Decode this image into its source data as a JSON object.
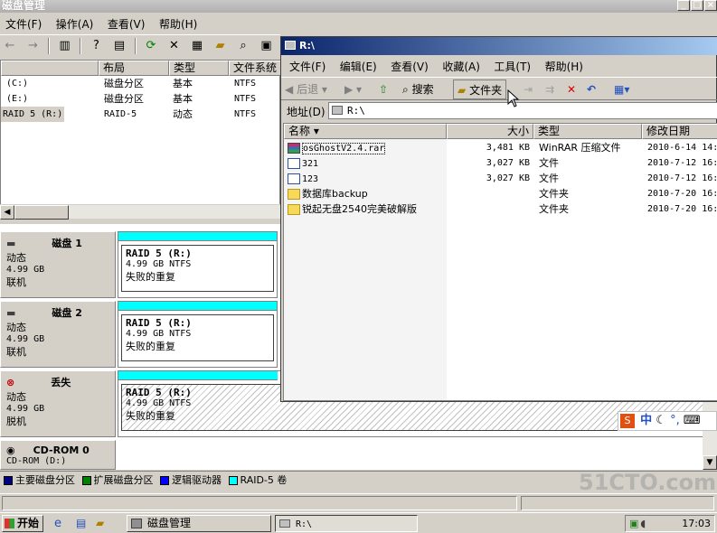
{
  "dm": {
    "title": "磁盘管理",
    "menu": [
      "文件(F)",
      "操作(A)",
      "查看(V)",
      "帮助(H)"
    ],
    "columns": [
      "布局",
      "类型",
      "文件系统"
    ],
    "volumes": [
      {
        "name": "(C:)",
        "layout": "磁盘分区",
        "type": "基本",
        "fs": "NTFS"
      },
      {
        "name": "(E:)",
        "layout": "磁盘分区",
        "type": "基本",
        "fs": "NTFS"
      },
      {
        "name": "RAID 5 (R:)",
        "layout": "RAID-5",
        "type": "动态",
        "fs": "NTFS"
      }
    ],
    "disks": [
      {
        "name": "磁盘 1",
        "kind": "动态",
        "size": "4.99 GB",
        "status": "联机",
        "vol": "RAID 5  (R:)",
        "vsize": "4.99 GB NTFS",
        "vstat": "失败的重复"
      },
      {
        "name": "磁盘 2",
        "kind": "动态",
        "size": "4.99 GB",
        "status": "联机",
        "vol": "RAID 5  (R:)",
        "vsize": "4.99 GB NTFS",
        "vstat": "失败的重复"
      },
      {
        "name": "丢失",
        "kind": "动态",
        "size": "4.99 GB",
        "status": "脱机",
        "vol": "RAID 5  (R:)",
        "vsize": "4.99 GB NTFS",
        "vstat": "失败的重复"
      }
    ],
    "cdrom": {
      "name": "CD-ROM 0",
      "sub": "CD-ROM  (D:)"
    },
    "legend": [
      {
        "label": "主要磁盘分区",
        "color": "#000080"
      },
      {
        "label": "扩展磁盘分区",
        "color": "#008000"
      },
      {
        "label": "逻辑驱动器",
        "color": "#0000ff"
      },
      {
        "label": "RAID-5 卷",
        "color": "#00ffff"
      }
    ]
  },
  "ex": {
    "title": "R:\\",
    "menu": [
      "文件(F)",
      "编辑(E)",
      "查看(V)",
      "收藏(A)",
      "工具(T)",
      "帮助(H)"
    ],
    "back": "后退",
    "search": "搜索",
    "folders": "文件夹",
    "addr_label": "地址(D)",
    "addr_value": "R:\\",
    "columns": [
      "名称",
      "大小",
      "类型",
      "修改日期"
    ],
    "files": [
      {
        "name": "osGhostV2.4.rar",
        "size": "3,481 KB",
        "type": "WinRAR 压缩文件",
        "date": "2010-6-14 14:",
        "icon": "rar"
      },
      {
        "name": "321",
        "size": "3,027 KB",
        "type": "文件",
        "date": "2010-7-12 16:",
        "icon": "file"
      },
      {
        "name": "123",
        "size": "3,027 KB",
        "type": "文件",
        "date": "2010-7-12 16:",
        "icon": "file"
      },
      {
        "name": "数据库backup",
        "size": "",
        "type": "文件夹",
        "date": "2010-7-20 16:",
        "icon": "folder"
      },
      {
        "name": "锐起无盘2540完美破解版",
        "size": "",
        "type": "文件夹",
        "date": "2010-7-20 16:",
        "icon": "folder"
      }
    ]
  },
  "ime": "中",
  "taskbar": {
    "start": "开始",
    "tasks": [
      "磁盘管理",
      "R:\\"
    ],
    "clock": "17:03"
  },
  "watermark": "51CTO.com"
}
